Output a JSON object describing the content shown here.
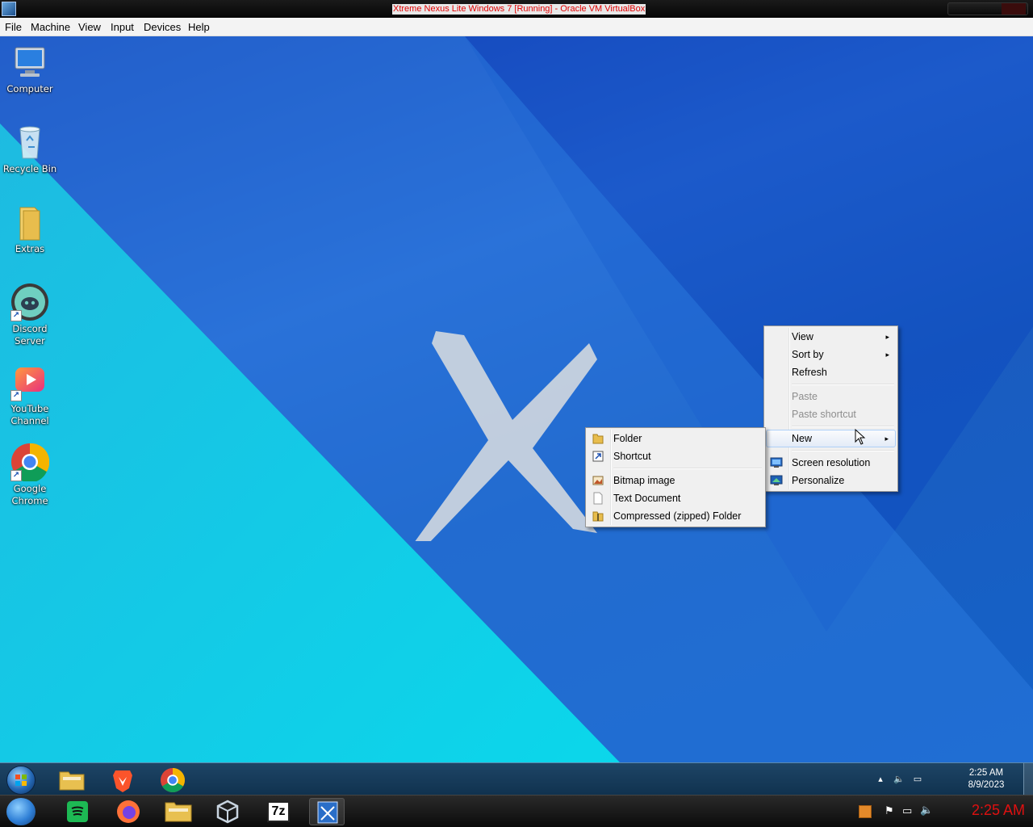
{
  "host": {
    "title": "Xtreme Nexus Lite Windows 7 [Running] - Oracle VM VirtualBox",
    "menu": [
      "File",
      "Machine",
      "View",
      "Input",
      "Devices",
      "Help"
    ],
    "clock": "2:25 AM"
  },
  "desktop": {
    "icons": [
      {
        "label": "Computer",
        "icon": "computer-icon"
      },
      {
        "label": "Recycle Bin",
        "icon": "recycle-bin-icon"
      },
      {
        "label": "Extras",
        "icon": "folder-icon"
      },
      {
        "label": "Discord Server",
        "icon": "discord-icon"
      },
      {
        "label": "YouTube Channel",
        "icon": "youtube-icon"
      },
      {
        "label": "Google Chrome",
        "icon": "chrome-icon"
      }
    ]
  },
  "context_menu": {
    "items": [
      {
        "label": "View",
        "submenu": true
      },
      {
        "label": "Sort by",
        "submenu": true
      },
      {
        "label": "Refresh"
      },
      {
        "label": "Paste",
        "disabled": true
      },
      {
        "label": "Paste shortcut",
        "disabled": true
      },
      {
        "label": "New",
        "submenu": true,
        "active": true
      },
      {
        "label": "Screen resolution",
        "icon": "screen-resolution-icon"
      },
      {
        "label": "Personalize",
        "icon": "personalize-icon"
      }
    ],
    "submenu_arrow": "▸"
  },
  "new_submenu": {
    "items": [
      {
        "label": "Folder",
        "icon": "folder-icon"
      },
      {
        "label": "Shortcut",
        "icon": "shortcut-icon"
      },
      {
        "label": "Bitmap image",
        "icon": "bitmap-icon"
      },
      {
        "label": "Text Document",
        "icon": "text-document-icon"
      },
      {
        "label": "Compressed (zipped) Folder",
        "icon": "zip-folder-icon"
      }
    ]
  },
  "taskbar": {
    "pinned": [
      "file-explorer-icon",
      "brave-icon",
      "chrome-icon"
    ],
    "time": "2:25 AM",
    "date": "8/9/2023"
  },
  "host_taskbar": {
    "pinned": [
      "spotify-icon",
      "firefox-icon",
      "file-explorer-icon",
      "virtualbox-icon",
      "7zip-icon",
      "virtualbox-vm-icon"
    ],
    "label_7zip": "7z"
  },
  "colors": {
    "host_title_text": "#e00000",
    "host_clock": "#e01010",
    "context_menu_bg": "#f0f0f0",
    "desktop_blue": "#1a5cc0",
    "desktop_teal": "#05e0ee"
  }
}
